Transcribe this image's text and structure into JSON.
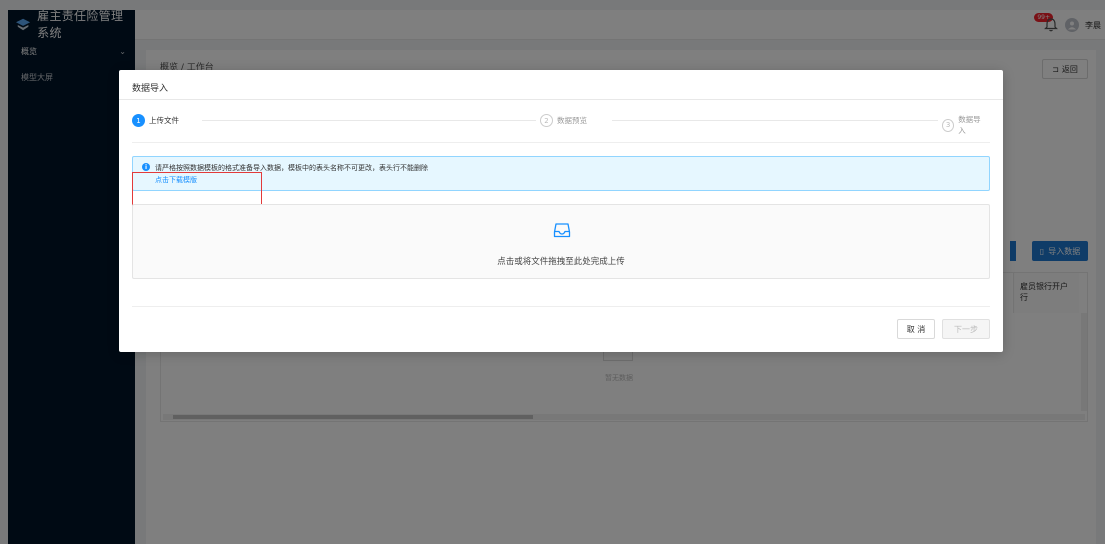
{
  "app": {
    "title": "雇主责任险管理系统"
  },
  "header": {
    "notification_badge": "99+",
    "user_name": "李晨"
  },
  "sidebar": {
    "items": [
      {
        "label": "概览",
        "expanded": true
      },
      {
        "label": "模型大屏"
      }
    ]
  },
  "page": {
    "breadcrumb": "概览 / 工作台",
    "back_label": "返回",
    "import_label": "导入数据",
    "table": {
      "visible_column_header": "雇员银行开户行",
      "empty_text": "暂无数据"
    }
  },
  "modal": {
    "title": "数据导入",
    "steps": [
      {
        "number": "1",
        "label": "上传文件",
        "status": "active"
      },
      {
        "number": "2",
        "label": "数据预览",
        "status": "wait"
      },
      {
        "number": "3",
        "label": "数据导入",
        "status": "wait"
      }
    ],
    "alert": {
      "message": "请严格按照数据模板的格式准备导入数据，模板中的表头名称不可更改，表头行不能删除",
      "link_text": "点击下载模版"
    },
    "upload": {
      "text": "点击或将文件拖拽至此处完成上传",
      "icon": "inbox-icon"
    },
    "buttons": {
      "cancel": "取 消",
      "next": "下一步"
    }
  },
  "colors": {
    "primary": "#1890ff",
    "sidebar_bg": "#001529",
    "highlight_box": "#e23a3a"
  }
}
